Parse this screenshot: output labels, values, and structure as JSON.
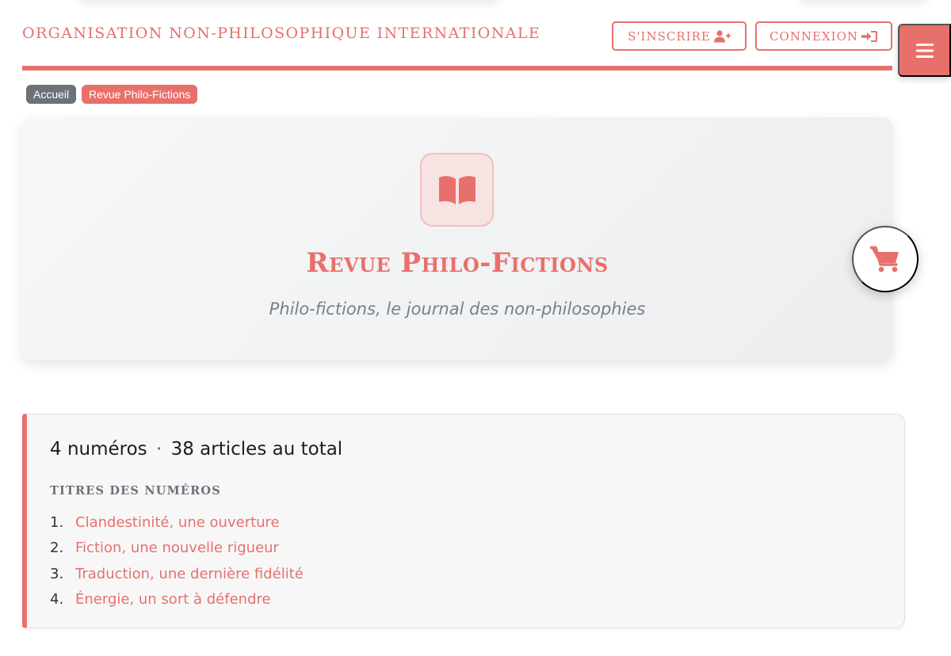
{
  "header": {
    "site_title": "ORGANISATION NON-PHILOSOPHIQUE INTERNATIONALE",
    "signup_label": "S'INSCRIRE",
    "login_label": "CONNEXION"
  },
  "breadcrumb": {
    "home": "Accueil",
    "current": "Revue Philo-Fictions"
  },
  "hero": {
    "icon": "book-open-icon",
    "title": "Revue Philo-Fictions",
    "subtitle": "Philo-fictions, le journal des non-philosophies"
  },
  "summary": {
    "issues_count": "4 numéros",
    "separator": "·",
    "articles_count": "38 articles au total",
    "heading": "TITRES DES NUMÉROS",
    "issues": [
      {
        "number": "1.",
        "title": "Clandestinité, une ouverture"
      },
      {
        "number": "2.",
        "title": "Fiction, une nouvelle rigueur"
      },
      {
        "number": "3.",
        "title": "Traduction, une dernière fidélité"
      },
      {
        "number": "4.",
        "title": "Énergie, un sort à défendre"
      }
    ]
  },
  "colors": {
    "accent": "#e8706b",
    "breadcrumb_home": "#6c727a",
    "subtitle": "#7a7f86"
  },
  "icons": {
    "signup": "user-plus-icon",
    "login": "sign-in-icon",
    "menu": "hamburger-icon",
    "cart": "shopping-cart-icon"
  }
}
